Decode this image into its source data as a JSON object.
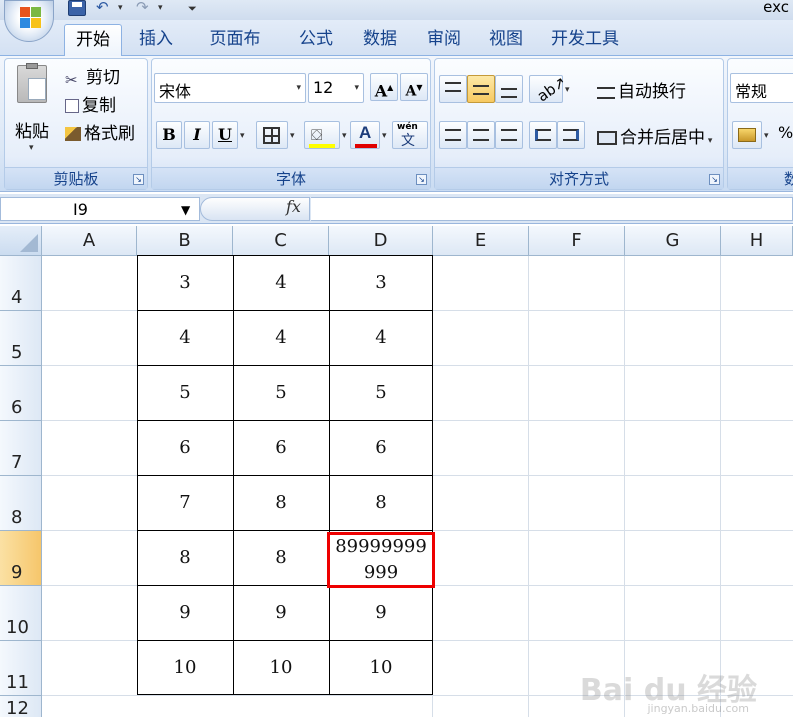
{
  "app": {
    "title_fragment": "exc"
  },
  "tabs": [
    {
      "label": "开始"
    },
    {
      "label": "插入"
    },
    {
      "label": "页面布局"
    },
    {
      "label": "公式"
    },
    {
      "label": "数据"
    },
    {
      "label": "审阅"
    },
    {
      "label": "视图"
    },
    {
      "label": "开发工具"
    }
  ],
  "active_tab": "开始",
  "ribbon": {
    "clipboard": {
      "group_label": "剪贴板",
      "paste": "粘贴",
      "cut": "剪切",
      "copy": "复制",
      "format_painter": "格式刷"
    },
    "font": {
      "group_label": "字体",
      "font_name": "宋体",
      "font_size": "12",
      "bold": "B",
      "italic": "I",
      "underline": "U",
      "phonetic": "wén"
    },
    "alignment": {
      "group_label": "对齐方式",
      "wrap_text": "自动换行",
      "merge_center": "合并后居中"
    },
    "number": {
      "group_label": "数",
      "format": "常规",
      "percent": "%"
    }
  },
  "formula_bar": {
    "name_box": "I9",
    "fx": "fx",
    "formula": ""
  },
  "columns": [
    "A",
    "B",
    "C",
    "D",
    "E",
    "F",
    "G",
    "H"
  ],
  "rows": [
    {
      "num": "4",
      "B": "3",
      "C": "4",
      "D": "3"
    },
    {
      "num": "5",
      "B": "4",
      "C": "4",
      "D": "4"
    },
    {
      "num": "6",
      "B": "5",
      "C": "5",
      "D": "5"
    },
    {
      "num": "7",
      "B": "6",
      "C": "6",
      "D": "6"
    },
    {
      "num": "8",
      "B": "7",
      "C": "8",
      "D": "8"
    },
    {
      "num": "9",
      "B": "8",
      "C": "8",
      "D_line1": "89999999",
      "D_line2": "999"
    },
    {
      "num": "10",
      "B": "9",
      "C": "9",
      "D": "9"
    },
    {
      "num": "11",
      "B": "10",
      "C": "10",
      "D": "10"
    },
    {
      "num": "12"
    }
  ],
  "highlighted_cell": "D9",
  "colors": {
    "highlight": "#ee0000",
    "selected_row_header": "#f6c66b",
    "ribbon_text": "#15428b"
  },
  "watermark": {
    "main": "Bai du 经验",
    "sub": "jingyan.baidu.com"
  }
}
